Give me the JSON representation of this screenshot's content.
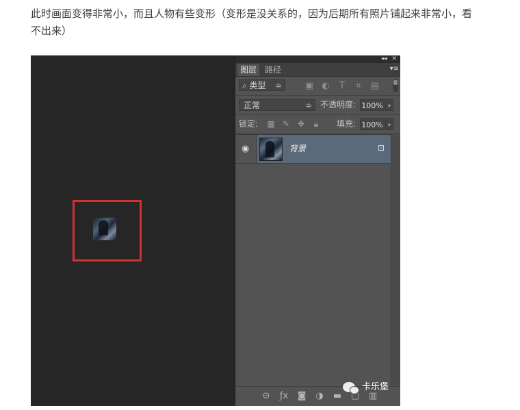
{
  "article": {
    "paragraph": "此时画面变得非常小，而且人物有些变形（变形是没关系的，因为后期所有照片铺起来非常小，看不出来）"
  },
  "panel": {
    "collapse_glyph": "◂◂",
    "close_glyph": "✕",
    "tabs": [
      {
        "label": "图层",
        "active": true
      },
      {
        "label": "路径",
        "active": false
      }
    ],
    "menu_glyph": "▾≡",
    "filter": {
      "select_label": "⌕ 类型",
      "select_arrow": "≑",
      "icons": [
        "image-icon",
        "adjustment-icon",
        "type-icon",
        "shape-icon",
        "smart-object-icon"
      ]
    },
    "blend": {
      "mode": "正常",
      "arrow": "≑",
      "opacity_label": "不透明度:",
      "opacity_value": "100%"
    },
    "lock": {
      "label": "锁定:",
      "icons": [
        "lock-pixels-icon",
        "lock-brush-icon",
        "lock-move-icon",
        "lock-all-icon"
      ],
      "fill_label": "填充:",
      "fill_value": "100%"
    },
    "layers": [
      {
        "name": "背景",
        "visible": true,
        "locked": true
      }
    ],
    "bottom_icons": [
      "link-icon",
      "fx-icon",
      "mask-icon",
      "adjustment-layer-icon",
      "group-folder-icon",
      "new-layer-icon",
      "trash-icon"
    ]
  },
  "watermark": {
    "text": "卡乐堡"
  },
  "colors": {
    "canvas_bg": "#262626",
    "panel_bg": "#535353",
    "selected_layer": "#5b6a7a",
    "highlight_frame": "#d2332e"
  }
}
